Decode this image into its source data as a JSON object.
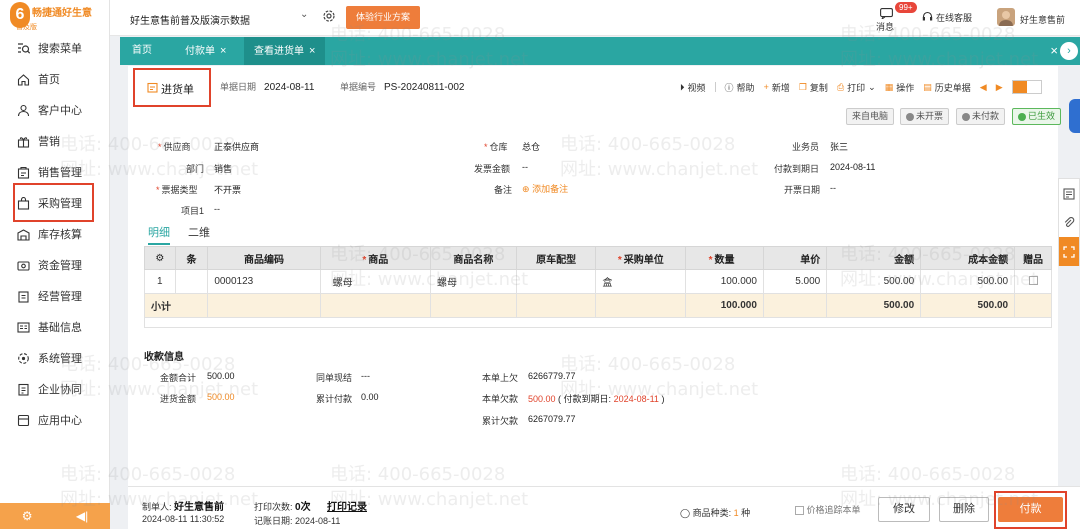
{
  "app": {
    "logo_glyph": "6",
    "logo_name": "畅捷通好生意",
    "logo_sub": "普及版",
    "company": "好生意售前普及版演示数据",
    "industry_btn": "体验行业方案",
    "message_label": "消息",
    "message_badge": "99+",
    "service_label": "在线客服",
    "username": "好生意售前"
  },
  "sidebar": {
    "items": [
      {
        "label": "搜索菜单",
        "icon": "search-menu-icon"
      },
      {
        "label": "首页",
        "icon": "home-icon"
      },
      {
        "label": "客户中心",
        "icon": "customer-icon"
      },
      {
        "label": "营销",
        "icon": "gift-icon"
      },
      {
        "label": "销售管理",
        "icon": "sales-icon"
      },
      {
        "label": "采购管理",
        "icon": "purchase-bag-icon"
      },
      {
        "label": "库存核算",
        "icon": "warehouse-icon"
      },
      {
        "label": "资金管理",
        "icon": "money-icon"
      },
      {
        "label": "经营管理",
        "icon": "clipboard-icon"
      },
      {
        "label": "基础信息",
        "icon": "info-card-icon"
      },
      {
        "label": "系统管理",
        "icon": "system-icon"
      },
      {
        "label": "企业协同",
        "icon": "collab-icon"
      },
      {
        "label": "应用中心",
        "icon": "apps-icon"
      }
    ]
  },
  "tabs": [
    {
      "label": "首页",
      "closable": false
    },
    {
      "label": "付款单",
      "closable": true
    },
    {
      "label": "查看进货单",
      "closable": true,
      "active": true
    }
  ],
  "doc": {
    "title": "进货单",
    "date_label": "单据日期",
    "date": "2024-08-11",
    "no_label": "单据编号",
    "no": "PS-20240811-002"
  },
  "toolbar": {
    "video": "视频",
    "help": "帮助",
    "add": "新增",
    "copy": "复制",
    "print": "打印",
    "ops": "操作",
    "history": "历史单据"
  },
  "status": {
    "source": "来自电脑",
    "invoice": "未开票",
    "paid": "未付款",
    "effective": "已生效"
  },
  "fields": {
    "supplier_label": "供应商",
    "supplier": "正泰供应商",
    "warehouse_label": "仓库",
    "warehouse": "总仓",
    "salesman_label": "业务员",
    "salesman": "张三",
    "dept_label": "部门",
    "dept": "销售",
    "invoice_amount_label": "发票金额",
    "invoice_amount": "--",
    "due_label": "付款到期日",
    "due": "2024-08-11",
    "invoice_type_label": "票据类型",
    "invoice_type": "不开票",
    "remark_label": "备注",
    "remark_add": "添加备注",
    "invoice_date_label": "开票日期",
    "invoice_date": "--",
    "item1_label": "项目1",
    "item1": "--"
  },
  "subtabs": {
    "detail": "明细",
    "qr": "二维"
  },
  "grid": {
    "headers": [
      "条",
      "商品编码",
      "商品",
      "商品名称",
      "原车配型",
      "采购单位",
      "数量",
      "单价",
      "金额",
      "成本金额",
      "赠品"
    ],
    "rows": [
      {
        "idx": "1",
        "code": "0000123",
        "goods": "螺母",
        "name": "螺母",
        "model": "",
        "unit": "盒",
        "qty": "100.000",
        "price": "5.000",
        "amount": "500.00",
        "cost": "500.00"
      }
    ],
    "subtotal": {
      "label": "小计",
      "qty": "100.000",
      "amount": "500.00",
      "cost": "500.00"
    }
  },
  "payment": {
    "title": "收款信息",
    "total_label": "金额合计",
    "total": "500.00",
    "purchase_amount_label": "进货金额",
    "purchase_amount": "500.00",
    "same_cash_label": "同单现结",
    "same_cash": "---",
    "cum_paid_label": "累计付款",
    "cum_paid": "0.00",
    "prev_owed_label": "本单上欠",
    "prev_owed": "6266779.77",
    "this_owed_label": "本单欠款",
    "this_owed": "500.00",
    "this_owed_due_prefix": "( 付款到期日:",
    "this_owed_due": "2024-08-11",
    "this_owed_due_suffix": ")",
    "cum_owed_label": "累计欠款",
    "cum_owed": "6267079.77"
  },
  "bottom": {
    "maker_label": "制单人:",
    "maker": "好生意售前",
    "made_time": "2024-08-11 11:30:52",
    "print_count_label": "打印次数:",
    "print_count": "0次",
    "print_log": "打印记录",
    "post_date_label": "记账日期:",
    "post_date": "2024-08-11",
    "kinds_label": "商品种类:",
    "kinds": "1",
    "kinds_unit": "种",
    "trace_label": "价格追踪本单",
    "modify": "修改",
    "delete": "删除",
    "pay": "付款"
  },
  "watermark": {
    "phone": "电话: 400-665-0028",
    "site": "网址: www.chanjet.net"
  },
  "colors": {
    "teal": "#2aa6a2",
    "orange": "#ee7d3b",
    "highlight": "#e0432b"
  }
}
